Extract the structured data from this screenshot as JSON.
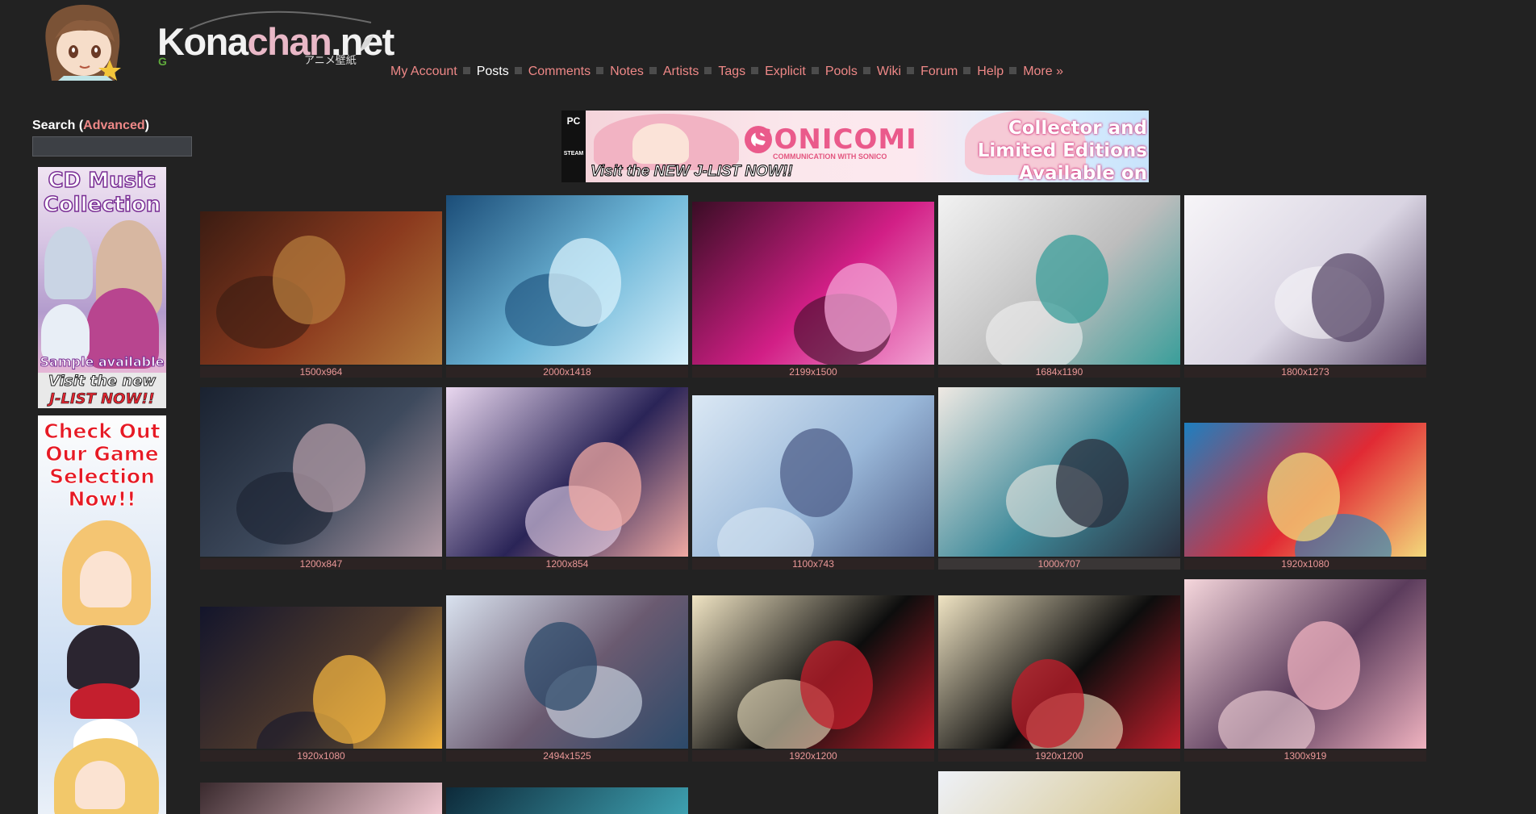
{
  "site": {
    "brand_main": "Kona",
    "brand_accent": "chan",
    "brand_tld": ".net",
    "tagline": "アニメ壁紙",
    "g_mark": "G"
  },
  "nav": [
    "My Account",
    "Posts",
    "Comments",
    "Notes",
    "Artists",
    "Tags",
    "Explicit",
    "Pools",
    "Wiki",
    "Forum",
    "Help",
    "More »"
  ],
  "nav_current": "Posts",
  "search": {
    "label": "Search",
    "advanced": "Advanced",
    "value": ""
  },
  "side_ads": {
    "cd": {
      "line1": "CD Music",
      "line2": "Collection",
      "sample": "Sample available",
      "cta1": "Visit the new",
      "cta2": "J-LIST NOW!!"
    },
    "game": {
      "line1": "Check Out",
      "line2": "Our Game",
      "line3": "Selection",
      "line4": "Now!!"
    }
  },
  "banner": {
    "pc": "PC",
    "steam": "STEAM",
    "title": "SONICOMI",
    "subtitle": "COMMUNICATION WITH SONICO",
    "cta": "Visit the NEW J-LIST NOW!!",
    "right1": "Collector and",
    "right2": "Limited Editions",
    "right3": "Available on Steam!"
  },
  "posts": [
    {
      "size": "1500x964",
      "colors": [
        "#3b1c12",
        "#8b3a1e",
        "#b47b3c"
      ]
    },
    {
      "size": "2000x1418",
      "colors": [
        "#1b4d78",
        "#6fb8d9",
        "#d7f0fb"
      ]
    },
    {
      "size": "2199x1500",
      "colors": [
        "#3a0d25",
        "#d21f86",
        "#f3a2d4"
      ]
    },
    {
      "size": "1684x1190",
      "colors": [
        "#f2f2f2",
        "#bdbdbd",
        "#3a9e9a"
      ]
    },
    {
      "size": "1800x1273",
      "colors": [
        "#f7f5f8",
        "#d9d4e2",
        "#5a4a6a"
      ]
    },
    {
      "size": "1200x847",
      "colors": [
        "#1a2230",
        "#3e4a5d",
        "#b39ba6"
      ]
    },
    {
      "size": "1200x854",
      "colors": [
        "#e9d7ef",
        "#2a2457",
        "#f0a9a3"
      ]
    },
    {
      "size": "1100x743",
      "colors": [
        "#dbe8f4",
        "#9ab8d9",
        "#4f5f8a"
      ]
    },
    {
      "size": "1000x707",
      "colors": [
        "#efe9e3",
        "#3e8a9a",
        "#2b2f3e"
      ]
    },
    {
      "size": "1920x1080",
      "colors": [
        "#1d7fc0",
        "#e12a34",
        "#f3d97b"
      ]
    },
    {
      "size": "1920x1080",
      "colors": [
        "#13152b",
        "#4f3a2d",
        "#f0b340"
      ]
    },
    {
      "size": "2494x1525",
      "colors": [
        "#d9e2ef",
        "#6a5a70",
        "#2c4a6a"
      ]
    },
    {
      "size": "1920x1200",
      "colors": [
        "#f0e4c3",
        "#0d0d0d",
        "#c11e2b"
      ]
    },
    {
      "size": "1920x1200",
      "colors": [
        "#f0e4c3",
        "#0d0d0d",
        "#c11e2b"
      ]
    },
    {
      "size": "1300x919",
      "colors": [
        "#f6d7dc",
        "#5b3c5c",
        "#f0b3c0"
      ]
    }
  ]
}
